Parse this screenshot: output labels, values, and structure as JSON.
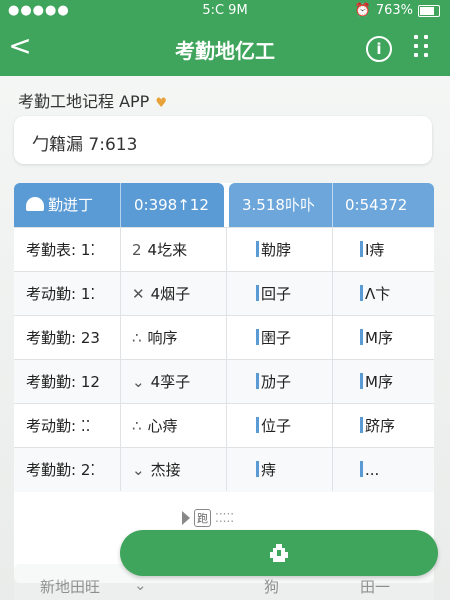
{
  "status": {
    "signal": "●●●●●",
    "time": "5:C 9M",
    "battery_percent": "763%"
  },
  "nav": {
    "back_label": "<",
    "title": "考勤地亿工",
    "info_label": "i"
  },
  "app_name": "考勤工地记程 APP",
  "card_text": "勹籍漏 7:613",
  "table": {
    "headers": [
      "勤迸丁",
      "0:398↑12",
      "3.518卟卟",
      "0:54372"
    ],
    "rows": [
      {
        "c1": "考勤表: 1⁚",
        "sym": "2",
        "c2": "4圪来",
        "c3": "勒脖",
        "c4": "I痔"
      },
      {
        "c1": "考动勤: 1⁚",
        "sym": "✕",
        "c2": "4烟子",
        "c3": "回子",
        "c4": "Λ卞"
      },
      {
        "c1": "考勤勤: 23",
        "sym": "∴",
        "c2": "响序",
        "c3": "圉子",
        "c4": "M序"
      },
      {
        "c1": "考勤勤: 12",
        "sym": "⌄",
        "c2": "4孪子",
        "c3": "劢子",
        "c4": "M序"
      },
      {
        "c1": "考动勤: ⁚⁚",
        "sym": "∴",
        "c2": "心痔",
        "c3": "位子",
        "c4": "跻序"
      },
      {
        "c1": "考勤勤: 2⁚",
        "sym": "⌄",
        "c2": "杰接",
        "c3": "痔",
        "c4": "..."
      }
    ]
  },
  "pager": {
    "page_box": "跑",
    "dots": "⁚⁚⁚⁚⁚"
  },
  "ghost_row": [
    "新地田旺",
    "⌄",
    "狗",
    "田一"
  ],
  "colors": {
    "brand_green": "#3fa45c",
    "header_blue": "#5b9bd5",
    "accent_orange": "#e8a23a"
  }
}
